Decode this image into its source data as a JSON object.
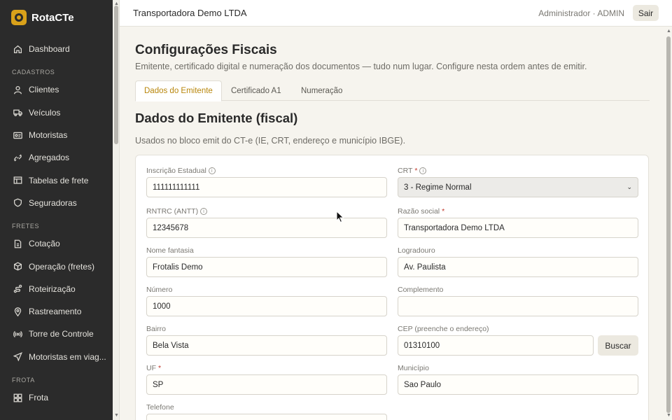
{
  "brand": {
    "name": "RotaCTe"
  },
  "sidebar": {
    "items": [
      {
        "label": "Dashboard",
        "icon": "home-icon"
      },
      {
        "section": "CADASTROS"
      },
      {
        "label": "Clientes",
        "icon": "user-icon"
      },
      {
        "label": "Veículos",
        "icon": "truck-icon"
      },
      {
        "label": "Motoristas",
        "icon": "id-card-icon"
      },
      {
        "label": "Agregados",
        "icon": "link-icon"
      },
      {
        "label": "Tabelas de frete",
        "icon": "table-icon"
      },
      {
        "label": "Seguradoras",
        "icon": "shield-icon"
      },
      {
        "section": "FRETES"
      },
      {
        "label": "Cotação",
        "icon": "document-icon"
      },
      {
        "label": "Operação (fretes)",
        "icon": "box-icon"
      },
      {
        "label": "Roteirização",
        "icon": "route-icon"
      },
      {
        "label": "Rastreamento",
        "icon": "pin-icon"
      },
      {
        "label": "Torre de Controle",
        "icon": "broadcast-icon"
      },
      {
        "label": "Motoristas em viag...",
        "icon": "send-icon"
      },
      {
        "section": "FROTA"
      },
      {
        "label": "Frota",
        "icon": "grid-icon"
      }
    ]
  },
  "topbar": {
    "company": "Transportadora Demo LTDA",
    "user": "Administrador · ADMIN",
    "logout_label": "Sair"
  },
  "page": {
    "title": "Configurações Fiscais",
    "subtitle": "Emitente, certificado digital e numeração dos documentos — tudo num lugar. Configure nesta ordem antes de emitir.",
    "tabs": [
      {
        "label": "Dados do Emitente",
        "active": true
      },
      {
        "label": "Certificado A1",
        "active": false
      },
      {
        "label": "Numeração",
        "active": false
      }
    ]
  },
  "section": {
    "title": "Dados do Emitente (fiscal)",
    "subtitle": "Usados no bloco emit do CT-e (IE, CRT, endereço e município IBGE)."
  },
  "form": {
    "ie": {
      "label": "Inscrição Estadual",
      "value": "111111111111"
    },
    "crt": {
      "label": "CRT",
      "value": "3 - Regime Normal"
    },
    "rntrc": {
      "label": "RNTRC (ANTT)",
      "value": "12345678"
    },
    "razao": {
      "label": "Razão social",
      "value": "Transportadora Demo LTDA"
    },
    "fantasia": {
      "label": "Nome fantasia",
      "value": "Frotalis Demo"
    },
    "logradouro": {
      "label": "Logradouro",
      "value": "Av. Paulista"
    },
    "numero": {
      "label": "Número",
      "value": "1000"
    },
    "complemento": {
      "label": "Complemento",
      "value": ""
    },
    "bairro": {
      "label": "Bairro",
      "value": "Bela Vista"
    },
    "cep": {
      "label": "CEP (preenche o endereço)",
      "value": "01310100",
      "button": "Buscar"
    },
    "uf": {
      "label": "UF",
      "value": "SP"
    },
    "municipio": {
      "label": "Município",
      "value": "Sao Paulo"
    },
    "telefone": {
      "label": "Telefone"
    }
  },
  "colors": {
    "accent": "#d9a11a",
    "sidebar_bg": "#2b2b2b",
    "active_tab": "#b8860b"
  }
}
